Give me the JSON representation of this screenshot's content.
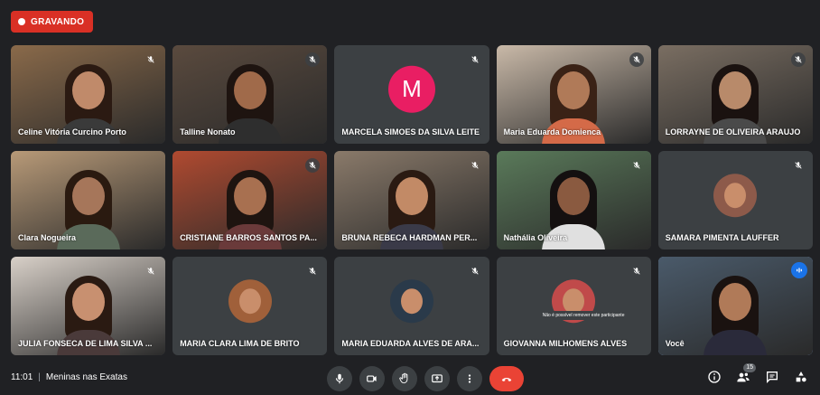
{
  "recording": {
    "label": "GRAVANDO"
  },
  "participants": [
    {
      "name": "Celine Vitória Curcino Porto",
      "bg": "#8a6a4a",
      "hair": "#2b1a12",
      "skin": "#c08a6a",
      "shirt": "#3a3a3a",
      "mic": "muted"
    },
    {
      "name": "Talline Nonato",
      "bg": "#5a4a3e",
      "hair": "#1e1410",
      "skin": "#a06a4a",
      "shirt": "#2e2e2e",
      "mic": "muted-solid"
    },
    {
      "name": "MARCELA SIMOES DA SILVA LEITE",
      "avatar_letter": "M",
      "avatar_color": "#e91e63",
      "mic": "muted"
    },
    {
      "name": "Maria Eduarda Domienca",
      "bg": "#c9b9a8",
      "hair": "#3a2216",
      "skin": "#b07a58",
      "shirt": "#d46a48",
      "mic": "muted-solid"
    },
    {
      "name": "LORRAYNE DE OLIVEIRA ARAUJO",
      "bg": "#7a6e62",
      "hair": "#1a1210",
      "skin": "#b88a6a",
      "shirt": "#4a4a4a",
      "mic": "muted-solid"
    },
    {
      "name": "Clara Nogueira",
      "bg": "#b89a78",
      "hair": "#2a1a10",
      "skin": "#a6765a",
      "shirt": "#5a6a5a",
      "mic": "none"
    },
    {
      "name": "CRISTIANE BARROS SANTOS PA...",
      "bg": "#b04a30",
      "hair": "#1e1410",
      "skin": "#a87050",
      "shirt": "#6a3a3a",
      "mic": "muted-solid"
    },
    {
      "name": "BRUNA REBECA HARDMAN PER...",
      "bg": "#8a7a6a",
      "hair": "#2a1a12",
      "skin": "#c28a66",
      "shirt": "#3a3a48",
      "mic": "muted"
    },
    {
      "name": "Nathália Oliveira",
      "bg": "#5a7a5a",
      "hair": "#141010",
      "skin": "#8a5a40",
      "shirt": "#e0e0e0",
      "mic": "muted"
    },
    {
      "name": "SAMARA PIMENTA LAUFFER",
      "avatar_photo": true,
      "avatar_color": "#8d5a4a",
      "mic": "muted"
    },
    {
      "name": "JULIA FONSECA DE LIMA SILVA ...",
      "bg": "#d8d0c8",
      "hair": "#2a1a12",
      "skin": "#c89070",
      "shirt": "#4a3a3a",
      "mic": "muted"
    },
    {
      "name": "MARIA CLARA LIMA DE BRITO",
      "avatar_photo": true,
      "avatar_color": "#a0603a",
      "mic": "muted"
    },
    {
      "name": "MARIA EDUARDA ALVES DE ARA...",
      "avatar_photo": true,
      "avatar_color": "#2a3a4a",
      "mic": "muted"
    },
    {
      "name": "GIOVANNA MILHOMENS ALVES",
      "avatar_photo": true,
      "avatar_color": "#c04a4a",
      "mic": "muted",
      "tooltip": "Não é possível remover este participante"
    },
    {
      "name": "Você",
      "bg": "#4a5a6a",
      "hair": "#1a1210",
      "skin": "#b07a58",
      "shirt": "#2a2a3a",
      "mic": "speaking",
      "active": true
    }
  ],
  "meeting": {
    "time": "11:01",
    "separator": "|",
    "title": "Meninas nas Exatas"
  },
  "people_count": "15",
  "colors": {
    "accent": "#8ab4f8",
    "end_call": "#ea4335",
    "recording": "#d93025"
  }
}
